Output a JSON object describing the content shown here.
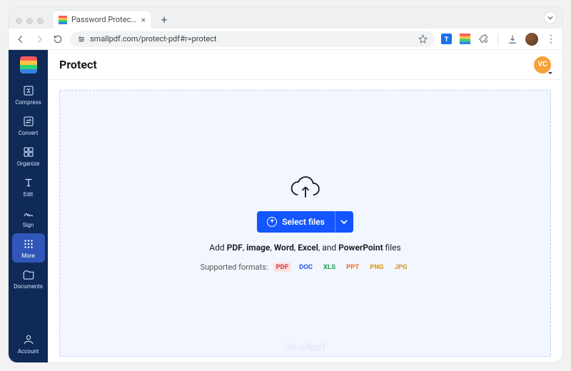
{
  "browser": {
    "tab_title": "Password Protect PDF - Enc…",
    "url": "smallpdf.com/protect-pdf#r=protect"
  },
  "sidebar": {
    "items": [
      {
        "id": "compress",
        "label": "Compress"
      },
      {
        "id": "convert",
        "label": "Convert"
      },
      {
        "id": "organize",
        "label": "Organize"
      },
      {
        "id": "edit",
        "label": "Edit"
      },
      {
        "id": "sign",
        "label": "Sign"
      },
      {
        "id": "more",
        "label": "More"
      },
      {
        "id": "documents",
        "label": "Documents"
      }
    ],
    "account_label": "Account"
  },
  "header": {
    "title": "Protect",
    "user_initials": "VC"
  },
  "dropzone": {
    "select_label": "Select files",
    "hint_prefix": "Add ",
    "hint_b1": "PDF",
    "hint_s1": ", ",
    "hint_b2": "image",
    "hint_s2": ", ",
    "hint_b3": "Word",
    "hint_s3": ", ",
    "hint_b4": "Excel",
    "hint_s4": ", and ",
    "hint_b5": "PowerPoint",
    "hint_suffix": " files",
    "formats_label": "Supported formats:",
    "formats": {
      "pdf": "PDF",
      "doc": "DOC",
      "xls": "XLS",
      "ppt": "PPT",
      "png": "PNG",
      "jpg": "JPG"
    },
    "watermark": "Smallpdf"
  }
}
